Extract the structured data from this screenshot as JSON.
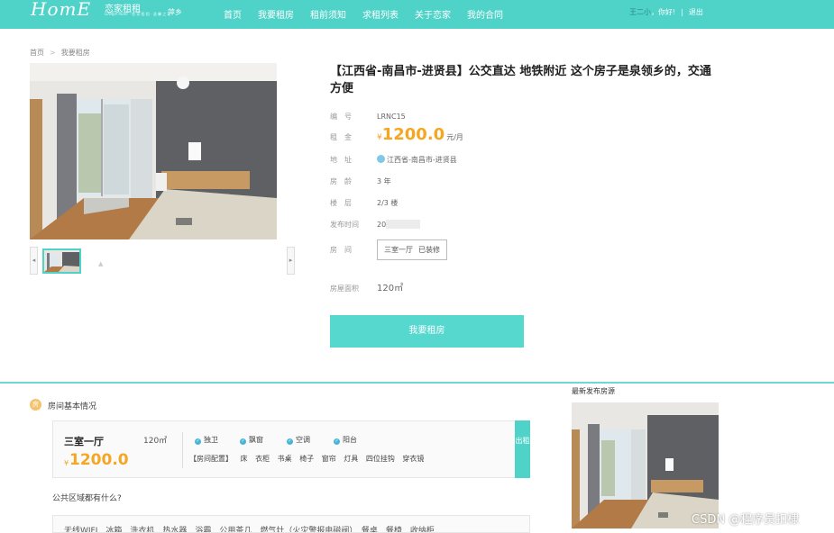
{
  "header": {
    "logo_text": "HomE",
    "logo_cn": "恋家租租",
    "logo_sub": "LIANJIA RENT · 恋 家 租 租 · 温 馨 之 家",
    "city": "萍乡",
    "nav": [
      "首页",
      "我要租房",
      "租前须知",
      "求租列表",
      "关于恋家",
      "我的合同"
    ],
    "user_name": "王二小",
    "greeting": "，你好!",
    "separator": "|",
    "logout": "退出"
  },
  "breadcrumb": {
    "home": "首页",
    "sep": ">",
    "current": "我要租房"
  },
  "listing": {
    "title": "【江西省-南昌市-进贤县】公交直达 地铁附近 这个房子是泉领乡的，交通方便",
    "code_label": "编　号",
    "code": "LRNC15",
    "rent_label": "租　金",
    "currency": "¥",
    "price": "1200.0",
    "price_unit": "元/月",
    "address_label": "地　址",
    "address": "江西省-南昌市-进贤县",
    "age_label": "房　龄",
    "age": "3 年",
    "floor_label": "楼　层",
    "floor": "2/3 楼",
    "publish_label": "发布时间",
    "publish_prefix": "20",
    "room_label": "房　间",
    "room_layout": "三室一厅",
    "room_decor": "已装修",
    "area_label": "房屋面积",
    "area": "120㎡",
    "rent_button": "我要租房"
  },
  "basic_info": {
    "icon": "房",
    "section_title": "房间基本情况",
    "layout": "三室一厅",
    "area": "120㎡",
    "currency": "¥",
    "price": "1200.0",
    "amenities": [
      "独卫",
      "飘窗",
      "空调",
      "阳台"
    ],
    "config_label": "【房间配置】",
    "config_items": [
      "床",
      "衣柜",
      "书桌",
      "椅子",
      "窗帘",
      "灯具",
      "四位挂钩",
      "穿衣镜"
    ],
    "rent_side": "出租",
    "public_question": "公共区域都有什么?",
    "public_items": "无线WIFI　冰箱　洗衣机　热水器　浴霸　公用茶几　燃气灶（火灾警报电磁阀）　餐桌　餐椅　收纳柜"
  },
  "sidebar": {
    "title": "最新发布房源"
  },
  "watermark": "CSDN @程序员扣棣"
}
